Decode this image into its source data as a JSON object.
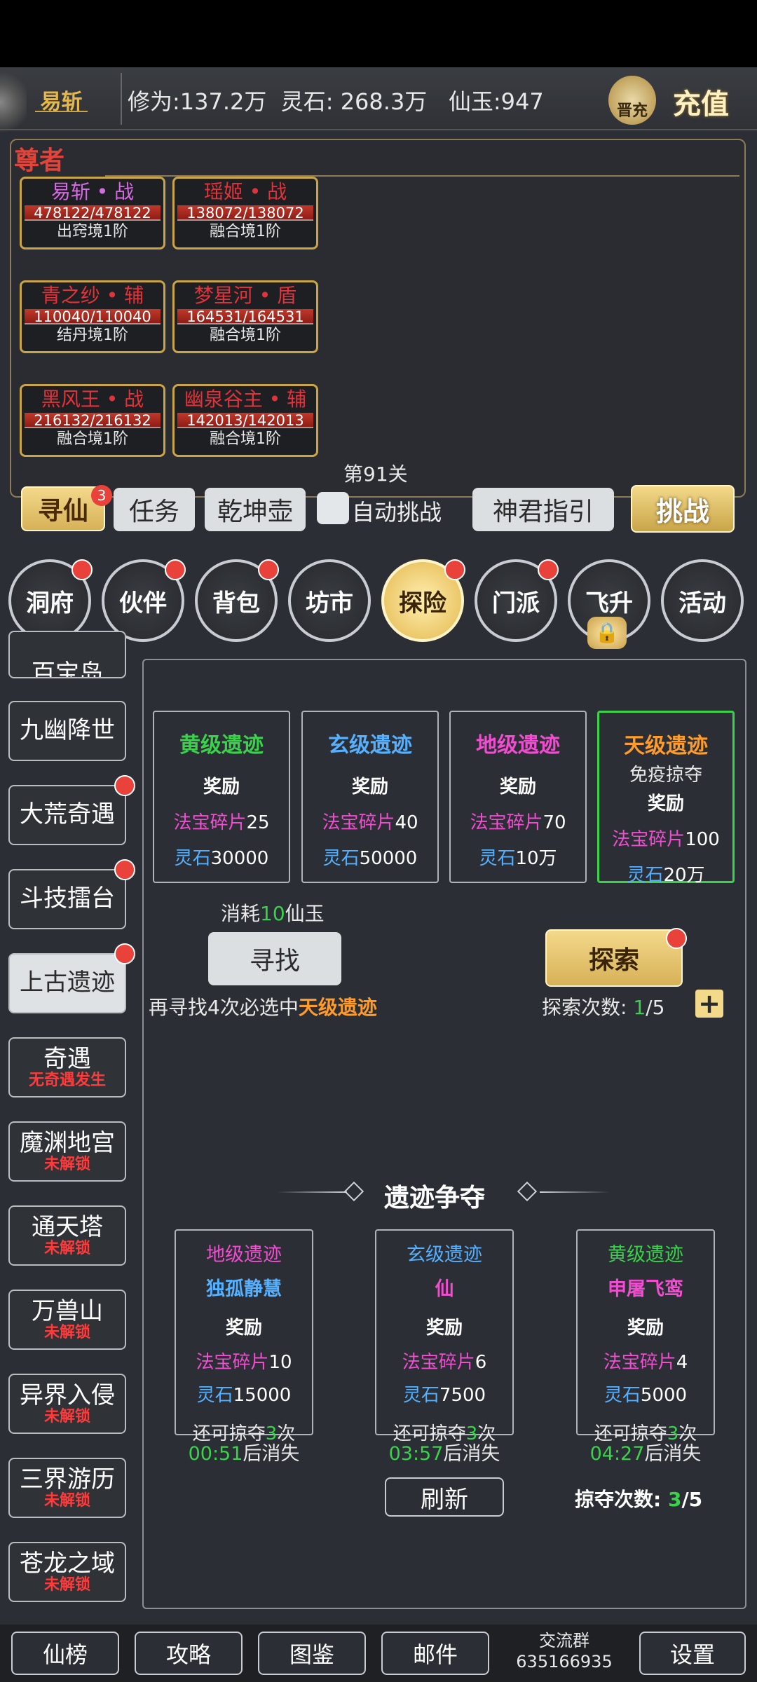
{
  "topbar": {
    "player_name": "易斩",
    "stats": "修为:137.2万  灵石: 268.3万   仙玉:947",
    "avatar_label": "晋充",
    "recharge_label": "充值"
  },
  "battle": {
    "title": "尊者",
    "level": "第91关",
    "heroes": [
      {
        "name": "易斩 • 战",
        "hp": "478122/478122",
        "rank": "出窍境1阶"
      },
      {
        "name": "瑶姬 • 战",
        "hp": "138072/138072",
        "rank": "融合境1阶"
      },
      {
        "name": "青之纱 • 辅",
        "hp": "110040/110040",
        "rank": "结丹境1阶"
      },
      {
        "name": "梦星河 • 盾",
        "hp": "164531/164531",
        "rank": "融合境1阶"
      },
      {
        "name": "黑风王 • 战",
        "hp": "216132/216132",
        "rank": "融合境1阶"
      },
      {
        "name": "幽泉谷主 • 辅",
        "hp": "142013/142013",
        "rank": "融合境1阶"
      }
    ]
  },
  "actions": {
    "xunxian": "寻仙",
    "xunxian_badge": "3",
    "task": "任务",
    "pot": "乾坤壶",
    "auto_challenge": "自动挑战",
    "guide": "神君指引",
    "challenge": "挑战"
  },
  "main_nav": [
    "洞府",
    "伙伴",
    "背包",
    "坊市",
    "探险",
    "门派",
    "飞升",
    "活动"
  ],
  "sidebar": {
    "partial_top": "百宝岛",
    "items": [
      {
        "label": "九幽降世",
        "sub": ""
      },
      {
        "label": "大荒奇遇",
        "sub": ""
      },
      {
        "label": "斗技擂台",
        "sub": ""
      },
      {
        "label": "上古遗迹",
        "sub": ""
      },
      {
        "label": "奇遇",
        "sub": "无奇遇发生"
      },
      {
        "label": "魔渊地宫",
        "sub": "未解锁"
      },
      {
        "label": "通天塔",
        "sub": "未解锁"
      },
      {
        "label": "万兽山",
        "sub": "未解锁"
      },
      {
        "label": "异界入侵",
        "sub": "未解锁"
      },
      {
        "label": "三界游历",
        "sub": "未解锁"
      },
      {
        "label": "苍龙之域",
        "sub": "未解锁"
      }
    ]
  },
  "ruins": [
    {
      "title": "黄级遗迹",
      "note": "",
      "reward": "奖励",
      "frag_label": "法宝碎片",
      "frag": "25",
      "stone_label": "灵石",
      "stone": "30000",
      "color": "#39d24a"
    },
    {
      "title": "玄级遗迹",
      "note": "",
      "reward": "奖励",
      "frag_label": "法宝碎片",
      "frag": "40",
      "stone_label": "灵石",
      "stone": "50000",
      "color": "#55b0ff"
    },
    {
      "title": "地级遗迹",
      "note": "",
      "reward": "奖励",
      "frag_label": "法宝碎片",
      "frag": "70",
      "stone_label": "灵石",
      "stone": "10万",
      "color": "#f04dd0"
    },
    {
      "title": "天级遗迹",
      "note": "免疫掠夺",
      "reward": "奖励",
      "frag_label": "法宝碎片",
      "frag": "100",
      "stone_label": "灵石",
      "stone": "20万",
      "color": "#ff9b2a"
    }
  ],
  "search": {
    "cost_prefix": "消耗",
    "cost_value": "10",
    "cost_suffix": "仙玉",
    "button": "寻找",
    "hint_prefix": "再寻找4次必选中",
    "hint_highlight": "天级遗迹",
    "explore_button": "探索",
    "explore_label": "探索次数:",
    "explore_used": "1",
    "explore_total": "/5"
  },
  "contest": {
    "title": "遗迹争夺",
    "cards": [
      {
        "type": "地级遗迹",
        "owner": "独孤静慧",
        "reward": "奖励",
        "frag_label": "法宝碎片",
        "frag": "10",
        "stone_label": "灵石",
        "stone": "15000",
        "remain_prefix": "还可掠夺",
        "remain": "3",
        "remain_suffix": "次",
        "timer": "00:51",
        "timer_suffix": "后消失",
        "color": "#f04dd0"
      },
      {
        "type": "玄级遗迹",
        "owner": "仙",
        "reward": "奖励",
        "frag_label": "法宝碎片",
        "frag": "6",
        "stone_label": "灵石",
        "stone": "7500",
        "remain_prefix": "还可掠夺",
        "remain": "3",
        "remain_suffix": "次",
        "timer": "03:57",
        "timer_suffix": "后消失",
        "color": "#55b0ff"
      },
      {
        "type": "黄级遗迹",
        "owner": "申屠飞鸾",
        "reward": "奖励",
        "frag_label": "法宝碎片",
        "frag": "4",
        "stone_label": "灵石",
        "stone": "5000",
        "remain_prefix": "还可掠夺",
        "remain": "3",
        "remain_suffix": "次",
        "timer": "04:27",
        "timer_suffix": "后消失",
        "color": "#39d24a"
      }
    ],
    "refresh": "刷新",
    "plunder_label": "掠夺次数:",
    "plunder_used": "3",
    "plunder_total": "/5"
  },
  "bottom": {
    "rank": "仙榜",
    "guide": "攻略",
    "atlas": "图鉴",
    "mail": "邮件",
    "group_label": "交流群",
    "group_id": "635166935",
    "settings": "设置"
  }
}
